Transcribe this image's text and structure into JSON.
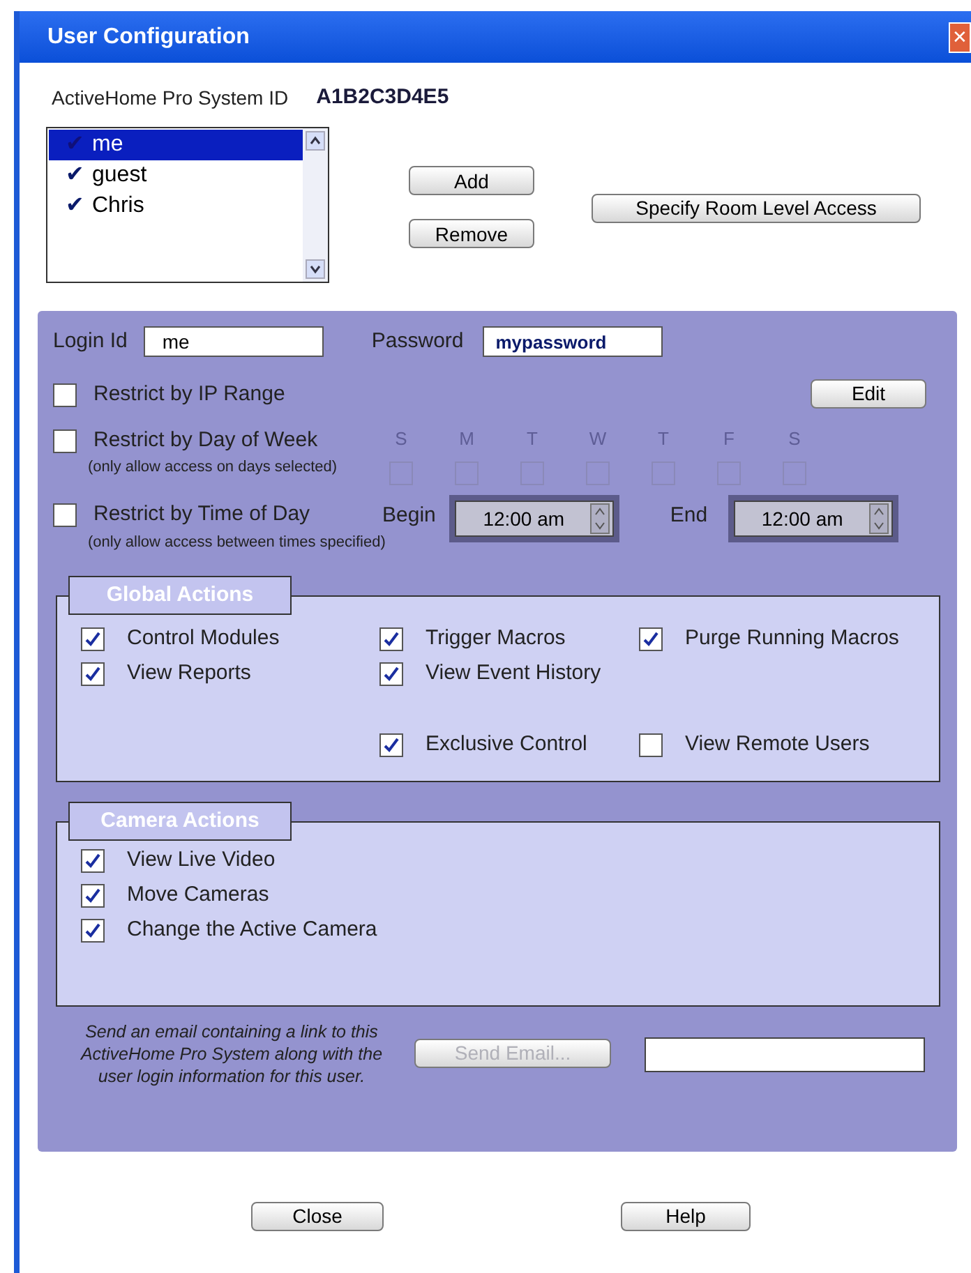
{
  "window": {
    "title": "User Configuration",
    "close": "✕"
  },
  "system_id": {
    "label": "ActiveHome Pro System ID",
    "value": "A1B2C3D4E5"
  },
  "users": [
    {
      "name": "me",
      "check": "✔",
      "selected": true
    },
    {
      "name": "guest",
      "check": "✔",
      "selected": false
    },
    {
      "name": "Chris",
      "check": "✔",
      "selected": false
    }
  ],
  "user_buttons": [
    "Add",
    "Remove"
  ],
  "room_button": "Specify Room Level Access",
  "login": {
    "label": "Login Id",
    "value": "me"
  },
  "password": {
    "label": "Password",
    "value": "mypassword"
  },
  "ip_range": {
    "label": "Restrict by IP Range",
    "checked": false,
    "button": "Edit"
  },
  "day_of_week": {
    "label": "Restrict by Day of Week",
    "note": "(only allow access on days selected)",
    "checked": false,
    "days": [
      {
        "letter": "S",
        "checked": false
      },
      {
        "letter": "M",
        "checked": false
      },
      {
        "letter": "T",
        "checked": false
      },
      {
        "letter": "W",
        "checked": false
      },
      {
        "letter": "T",
        "checked": false
      },
      {
        "letter": "F",
        "checked": false
      },
      {
        "letter": "S",
        "checked": false
      }
    ]
  },
  "time_of_day": {
    "label": "Restrict by Time of Day",
    "note": "(only allow access between times specified)",
    "checked": false,
    "begin_label": "Begin",
    "begin": "12:00 am",
    "end_label": "End",
    "end": "12:00 am"
  },
  "global_actions": {
    "title": "Global Actions",
    "top_rows": [
      [
        {
          "label": "Control Modules",
          "checked": true
        },
        {
          "label": "Trigger Macros",
          "checked": true
        },
        {
          "label": "Purge Running Macros",
          "checked": true
        }
      ],
      [
        {
          "label": "View Reports",
          "checked": true
        },
        {
          "label": "View Event History",
          "checked": true
        }
      ]
    ],
    "bottom_row": [
      {
        "label": "Exclusive Control",
        "checked": true
      },
      {
        "label": "View Remote Users",
        "checked": false
      }
    ]
  },
  "camera_actions": {
    "title": "Camera Actions",
    "items": [
      {
        "label": "View Live Video",
        "checked": true
      },
      {
        "label": "Move Cameras",
        "checked": true
      },
      {
        "label": "Change the Active Camera",
        "checked": true
      }
    ]
  },
  "email": {
    "note": "Send an email containing a link to this ActiveHome Pro System along with the user login information for this user.",
    "button": "Send Email...",
    "button_disabled": true
  },
  "footer_buttons": [
    "Close",
    "Help"
  ]
}
